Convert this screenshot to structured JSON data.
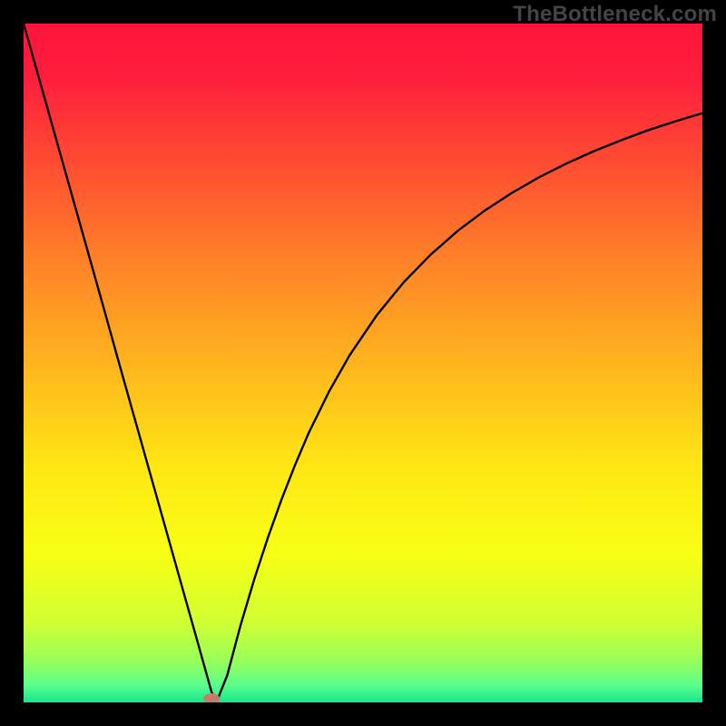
{
  "watermark": "TheBottleneck.com",
  "chart_data": {
    "type": "line",
    "title": "",
    "xlabel": "",
    "ylabel": "",
    "xlim": [
      0,
      100
    ],
    "ylim": [
      0,
      100
    ],
    "grid": false,
    "legend": false,
    "background": {
      "type": "vertical-gradient",
      "stops": [
        {
          "offset": 0.0,
          "color": "#ff143c"
        },
        {
          "offset": 0.08,
          "color": "#ff1e3c"
        },
        {
          "offset": 0.2,
          "color": "#ff4a32"
        },
        {
          "offset": 0.35,
          "color": "#ff8228"
        },
        {
          "offset": 0.5,
          "color": "#ffb41e"
        },
        {
          "offset": 0.65,
          "color": "#ffe614"
        },
        {
          "offset": 0.78,
          "color": "#f8ff14"
        },
        {
          "offset": 0.88,
          "color": "#d2ff32"
        },
        {
          "offset": 0.94,
          "color": "#96ff5a"
        },
        {
          "offset": 0.975,
          "color": "#5aff8c"
        },
        {
          "offset": 1.0,
          "color": "#14e68c"
        }
      ]
    },
    "series": [
      {
        "name": "curve",
        "color": "#000000",
        "x": [
          0.0,
          2.0,
          4.0,
          6.0,
          8.0,
          10.0,
          12.0,
          14.0,
          16.0,
          18.0,
          20.0,
          22.0,
          24.0,
          26.0,
          27.0,
          27.7,
          28.4,
          30.0,
          32.0,
          34.0,
          36.0,
          38.0,
          40.0,
          42.0,
          45.0,
          48.0,
          52.0,
          56.0,
          60.0,
          64.0,
          68.0,
          72.0,
          76.0,
          80.0,
          84.0,
          88.0,
          92.0,
          96.0,
          100.0
        ],
        "y": [
          100.0,
          92.9,
          85.8,
          78.7,
          71.6,
          64.5,
          57.4,
          50.2,
          43.1,
          36.0,
          28.9,
          21.8,
          14.7,
          7.6,
          4.0,
          1.5,
          0.0,
          4.0,
          11.5,
          18.2,
          24.3,
          29.9,
          35.0,
          39.7,
          45.8,
          51.1,
          57.0,
          61.9,
          66.0,
          69.5,
          72.5,
          75.1,
          77.4,
          79.4,
          81.2,
          82.8,
          84.3,
          85.6,
          86.8
        ]
      }
    ],
    "marker": {
      "name": "min-point",
      "x": 27.7,
      "y": 0.0,
      "color": "#c97a6a",
      "rx": 9,
      "ry": 6
    }
  }
}
